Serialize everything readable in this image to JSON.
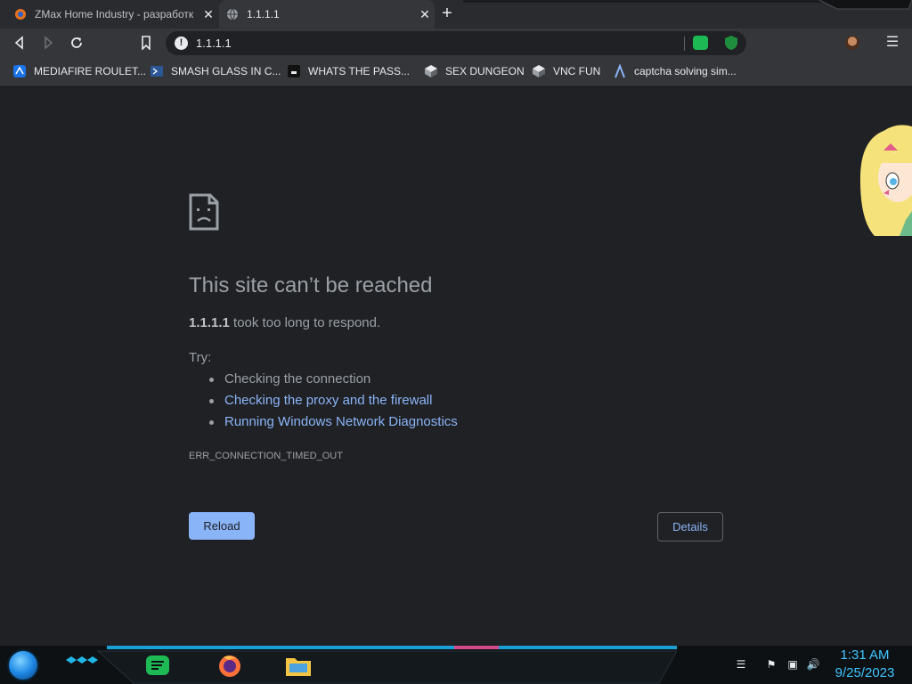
{
  "tabs": [
    {
      "title": "ZMax Home Industry - разработк",
      "active": false
    },
    {
      "title": "1.1.1.1",
      "active": true
    }
  ],
  "toolbar": {
    "address": "1.1.1.1"
  },
  "bookmarks": [
    {
      "label": "MEDIAFIRE ROULET..."
    },
    {
      "label": "SMASH GLASS IN C..."
    },
    {
      "label": "WHATS THE PASS..."
    },
    {
      "label": "SEX DUNGEON"
    },
    {
      "label": "VNC FUN"
    },
    {
      "label": "captcha solving sim..."
    }
  ],
  "error": {
    "title": "This site can’t be reached",
    "host": "1.1.1.1",
    "message": " took too long to respond.",
    "try_label": "Try:",
    "suggestions": [
      "Checking the connection",
      "Checking the proxy and the firewall",
      "Running Windows Network Diagnostics"
    ],
    "code": "ERR_CONNECTION_TIMED_OUT",
    "reload_label": "Reload",
    "details_label": "Details"
  },
  "taskbar": {
    "time": "1:31 AM",
    "date": "9/25/2023"
  },
  "colors": {
    "accent": "#8ab4f8",
    "clock": "#3ec6ff",
    "page_bg": "#202124"
  }
}
